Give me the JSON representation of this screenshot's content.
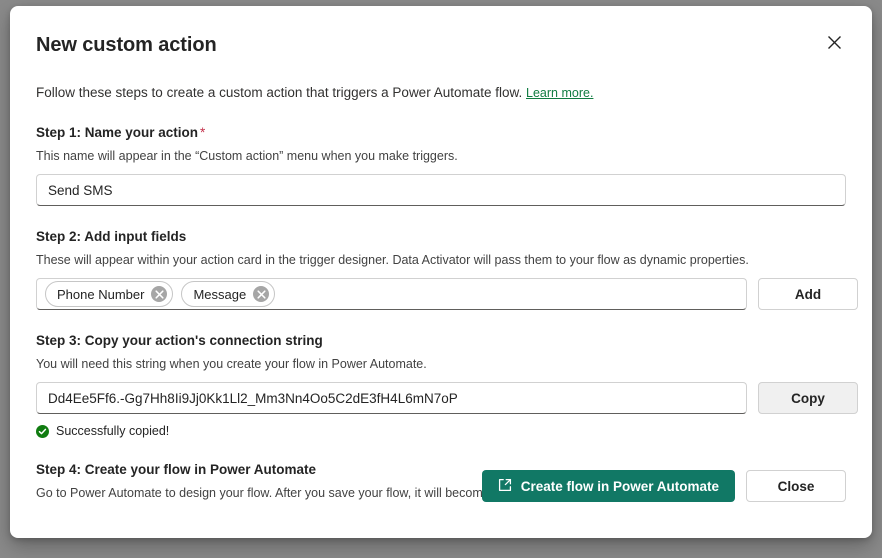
{
  "dialog": {
    "title": "New custom action",
    "close_icon": "close-icon",
    "intro": {
      "text": "Follow these steps to create a custom action that triggers a Power Automate flow.",
      "link_label": "Learn more.",
      "link_color": "#107c41"
    },
    "steps": [
      {
        "title": "Step 1: Name your action",
        "required_marker": "*",
        "description": "This name will appear in the “Custom action” menu when you make triggers.",
        "input_value": "Send SMS"
      },
      {
        "title": "Step 2: Add input fields",
        "description": "These will appear within your action card in the trigger designer. Data Activator will pass them to your flow as dynamic properties.",
        "chips": [
          {
            "label": "Phone Number",
            "remove_icon": "close-circle-icon"
          },
          {
            "label": "Message",
            "remove_icon": "close-circle-icon"
          }
        ],
        "button_label": "Add"
      },
      {
        "title": "Step 3: Copy your action's connection string",
        "description": "You will need this string when you create your flow in Power Automate.",
        "input_value": "Dd4Ee5Ff6.-Gg7Hh8Ii9Jj0Kk1Ll2_Mm3Nn4Oo5C2dE3fH4L6mN7oP",
        "button_label": "Copy",
        "status": {
          "icon": "success-check-icon",
          "text": "Successfully copied!",
          "color": "#107c10"
        }
      },
      {
        "title": "Step 4: Create your flow in Power Automate",
        "description": "Go to Power Automate to design your flow. After you save your flow, it will become available to use in Data Activator."
      }
    ],
    "footer": {
      "primary_label": "Create flow in Power Automate",
      "primary_icon": "open-in-new-window-icon",
      "primary_color": "#117865",
      "secondary_label": "Close"
    }
  }
}
